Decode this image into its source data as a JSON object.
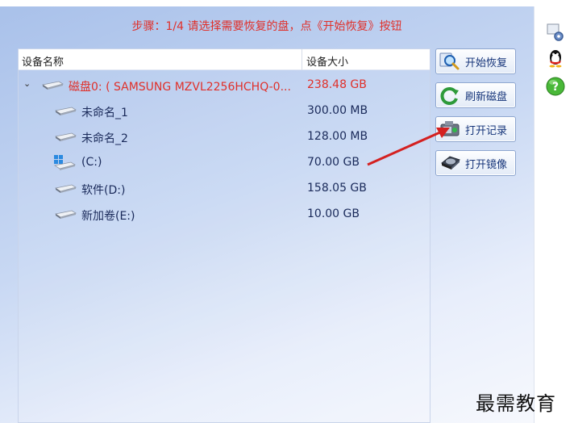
{
  "window": {
    "title": ""
  },
  "step_text": "步骤：1/4 请选择需要恢复的盘，点《开始恢复》按钮",
  "table": {
    "headers": {
      "name": "设备名称",
      "size": "设备大小"
    },
    "root": {
      "name": "磁盘0: ( SAMSUNG MZVL2256HCHQ-0...",
      "size": "238.48 GB",
      "expanded": true
    },
    "partitions": [
      {
        "name": "未命名_1",
        "size": "300.00 MB",
        "icon": "drive-icon"
      },
      {
        "name": "未命名_2",
        "size": "128.00 MB",
        "icon": "drive-icon"
      },
      {
        "name": "(C:)",
        "size": "70.00 GB",
        "icon": "windows-drive-icon"
      },
      {
        "name": "软件(D:)",
        "size": "158.05 GB",
        "icon": "drive-icon"
      },
      {
        "name": "新加卷(E:)",
        "size": "10.00 GB",
        "icon": "drive-icon"
      }
    ]
  },
  "buttons": {
    "start": "开始恢复",
    "refresh": "刷新磁盘",
    "open_log": "打开记录",
    "open_image": "打开镜像"
  },
  "sidebar_icons": [
    "settings-gear-icon",
    "qq-penguin-icon",
    "help-icon"
  ],
  "watermark": "最需教育",
  "colors": {
    "accent_red": "#e0302a",
    "button_text": "#16357a",
    "bg_blue": "#a9c1ea"
  }
}
